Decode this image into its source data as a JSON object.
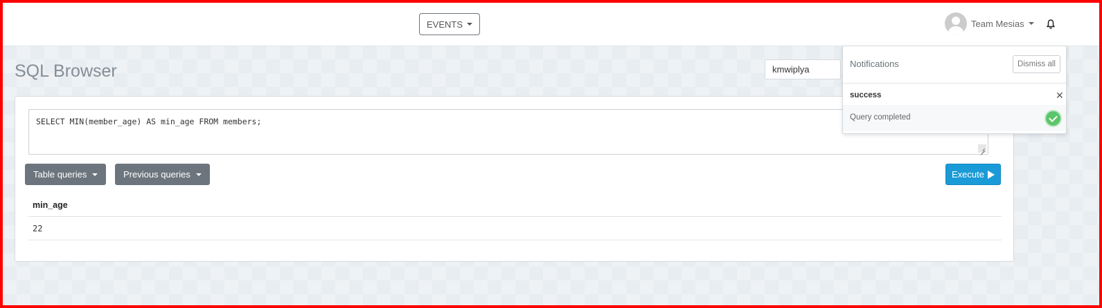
{
  "topbar": {
    "events_label": "EVENTS",
    "user_name": "Team Mesias"
  },
  "page": {
    "title": "SQL Browser",
    "database": "kmwiplya"
  },
  "editor": {
    "query": "SELECT MIN(member_age) AS min_age FROM members;"
  },
  "buttons": {
    "table_queries": "Table queries",
    "previous_queries": "Previous queries",
    "execute": "Execute"
  },
  "results": {
    "columns": [
      "min_age"
    ],
    "rows": [
      [
        "22"
      ]
    ]
  },
  "notifications": {
    "title": "Notifications",
    "dismiss_all": "Dismiss all",
    "items": [
      {
        "type": "success",
        "message": "Query completed"
      }
    ]
  }
}
